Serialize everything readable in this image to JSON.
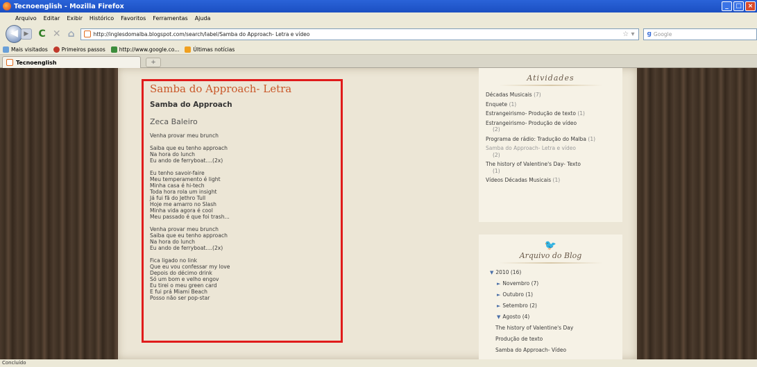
{
  "window": {
    "title": "Tecnoenglish - Mozilla Firefox"
  },
  "menu": [
    "Arquivo",
    "Editar",
    "Exibir",
    "Histórico",
    "Favoritos",
    "Ferramentas",
    "Ajuda"
  ],
  "nav": {
    "url": "http://inglesdomalba.blogspot.com/search/label/Samba do Approach- Letra e vídeo",
    "search_placeholder": "Google"
  },
  "bookmarks": [
    "Mais visitados",
    "Primeiros passos",
    "http://www.google.co...",
    "Últimas notícias"
  ],
  "tab": {
    "title": "Tecnoenglish"
  },
  "post": {
    "title": "Samba do Approach- Letra",
    "subtitle": "Samba do Approach",
    "author": "Zeca Baleiro",
    "stanzas": [
      [
        "Venha provar meu brunch"
      ],
      [
        "Saiba que eu tenho approach",
        "Na hora do lunch",
        "Eu ando de ferryboat....(2x)"
      ],
      [
        "Eu tenho savoir-faire",
        "Meu temperamento é light",
        "Minha casa é hi-tech",
        "Toda hora rola um insight",
        "Já fui fã do Jethro Tull",
        "Hoje me amarro no Slash",
        "Minha vida agora é cool",
        "Meu passado é que foi trash..."
      ],
      [
        "Venha provar meu brunch",
        "Saiba que eu tenho approach",
        "Na hora do lunch",
        "Eu ando de ferryboat....(2x)"
      ],
      [
        "Fica ligado no link",
        "Que eu vou confessar my love",
        "Depois do décimo drink",
        "Só um bom e velho engov",
        "Eu tirei o meu green card",
        "E fui prá Miami Beach",
        "Posso não ser pop-star"
      ]
    ]
  },
  "sidebar": {
    "labels_title": "Atividades",
    "labels": [
      {
        "text": "Décadas Musicais",
        "count": "(7)",
        "dim": false
      },
      {
        "text": "Enquete",
        "count": "(1)",
        "dim": false
      },
      {
        "text": "Estrangeirismo- Produção de texto",
        "count": "(1)",
        "dim": false
      },
      {
        "text": "Estrangeirismo- Produção de vídeo",
        "count": "(2)",
        "dim": false
      },
      {
        "text": "Programa de rádio: Tradução do Malba",
        "count": "(1)",
        "dim": false
      },
      {
        "text": "Samba do Approach- Letra e vídeo",
        "count": "(2)",
        "dim": true
      },
      {
        "text": "The history of Valentine's Day- Texto",
        "count": "(1)",
        "dim": false
      },
      {
        "text": "Vídeos Décadas Musicais",
        "count": "(1)",
        "dim": false
      }
    ],
    "archive_title": "Arquivo do Blog",
    "archive": [
      {
        "tri": "▼",
        "text": "2010",
        "count": "(16)",
        "level": "lvl1"
      },
      {
        "tri": "►",
        "text": "Novembro",
        "count": "(7)",
        "level": "lvl2"
      },
      {
        "tri": "►",
        "text": "Outubro",
        "count": "(1)",
        "level": "lvl2"
      },
      {
        "tri": "►",
        "text": "Setembro",
        "count": "(2)",
        "level": "lvl2"
      },
      {
        "tri": "▼",
        "text": "Agosto",
        "count": "(4)",
        "level": "lvl2"
      },
      {
        "tri": "",
        "text": "The history of Valentine's Day",
        "count": "",
        "level": "lvl3"
      },
      {
        "tri": "",
        "text": "Produção de texto",
        "count": "",
        "level": "lvl3"
      },
      {
        "tri": "",
        "text": "Samba do Approach- Vídeo",
        "count": "",
        "level": "lvl3"
      }
    ]
  },
  "status": "Concluído"
}
